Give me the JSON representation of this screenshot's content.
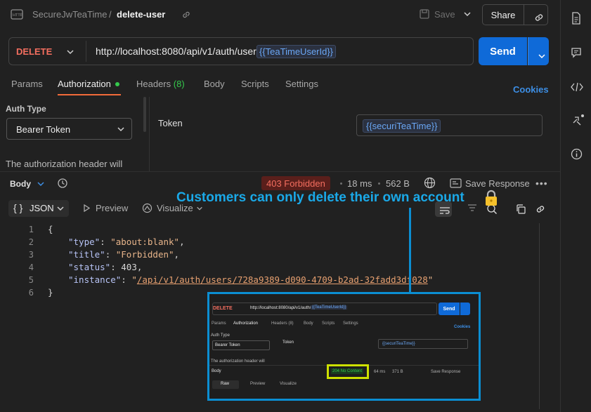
{
  "header": {
    "collection": "SecureJwTeaTime",
    "separator": "/",
    "request_name": "delete-user",
    "save_label": "Save",
    "share_label": "Share"
  },
  "request": {
    "method": "DELETE",
    "url": "http://localhost:8080/api/v1/auth/users/",
    "url_variable": "{{TeaTimeUserId}}",
    "send_label": "Send"
  },
  "tabs": [
    {
      "label": "Params"
    },
    {
      "label": "Authorization"
    },
    {
      "label": "Headers",
      "count": "(8)"
    },
    {
      "label": "Body"
    },
    {
      "label": "Scripts"
    },
    {
      "label": "Settings"
    }
  ],
  "cookies_label": "Cookies",
  "auth": {
    "type_label": "Auth Type",
    "type_value": "Bearer Token",
    "help_text": "The authorization header will",
    "token_label": "Token",
    "token_value": "{{securiTeaTime}}"
  },
  "response": {
    "body_label": "Body",
    "status": "403 Forbidden",
    "time": "18 ms",
    "size": "562 B",
    "save_label": "Save Response",
    "more": "•••",
    "format": "JSON",
    "preview_label": "Preview",
    "visualize_label": "Visualize",
    "line_numbers": [
      "1",
      "2",
      "3",
      "4",
      "5",
      "6"
    ],
    "json": {
      "open": "{",
      "type_key": "\"type\"",
      "type_val": "\"about:blank\"",
      "title_key": "\"title\"",
      "title_val": "\"Forbidden\"",
      "status_key": "\"status\"",
      "status_val": "403",
      "instance_key": "\"instance\"",
      "instance_q1": "\"",
      "instance_val": "/api/v1/auth/users/728a9389-d090-4709-b2ad-32fadd3df028",
      "instance_q2": "\"",
      "close": "}"
    }
  },
  "annotation": {
    "text": "Customers can only delete their own account",
    "color": "#1aa9e8"
  },
  "inset": {
    "method": "DELETE",
    "url": "http://localhost:8080/api/v1/auth/users/",
    "url_variable": "{{TeaTimeUserId}}",
    "send_label": "Send",
    "tabs": [
      "Params",
      "Authorization",
      "Headers (8)",
      "Body",
      "Scripts",
      "Settings"
    ],
    "cookies_label": "Cookies",
    "auth_type_label": "Auth Type",
    "auth_type_value": "Bearer Token",
    "token_label": "Token",
    "token_value": "{{securiTeaTime}}",
    "help_text": "The authorization header will",
    "body_label": "Body",
    "status": "204 No Content",
    "time": "64 ms",
    "size": "371 B",
    "save_label": "Save Response",
    "format": "Raw",
    "preview_label": "Preview",
    "visualize_label": "Visualize"
  },
  "colors": {
    "accent": "#0f6ad8",
    "method_delete": "#f36e5f",
    "status_error": "#f36e5f",
    "status_success": "#35c94c",
    "highlight": "#cde000",
    "annotation_border": "#0b8ed2"
  },
  "icons": [
    "http-icon",
    "link-icon",
    "save-icon",
    "chevron-down-icon",
    "history-icon",
    "globe-icon",
    "save-response-icon",
    "preview-icon",
    "visualize-icon",
    "wrap-icon",
    "filter-icon",
    "search-icon",
    "copy-icon",
    "link-icon",
    "document-icon",
    "comment-icon",
    "code-icon",
    "related-icon",
    "info-icon",
    "lock-icon"
  ]
}
